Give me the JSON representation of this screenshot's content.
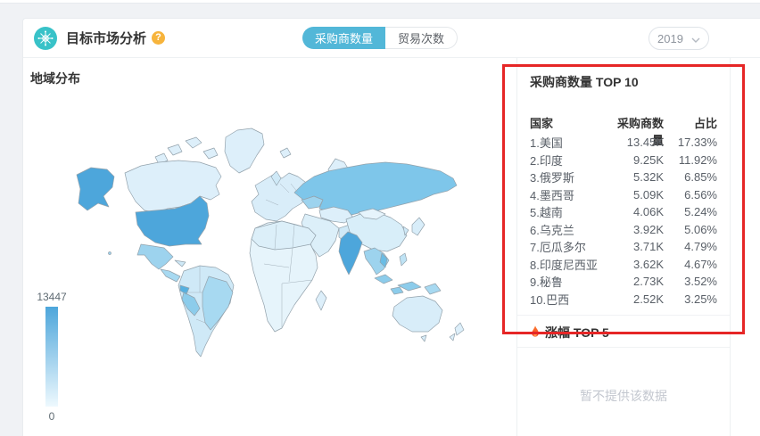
{
  "colors": {
    "icon_teal": "#38c2c8",
    "tab_active_bg": "#52b7d8",
    "annotation_red": "#e62626",
    "help_orange": "#f7b43c",
    "map_high": "#4da6db",
    "map_low": "#eef9fe",
    "flame_orange": "#ff8033",
    "flame_red": "#ef3c1f"
  },
  "header": {
    "title": "目标市场分析",
    "help_glyph": "?",
    "tabs": [
      {
        "label": "采购商数量",
        "active": true
      },
      {
        "label": "贸易次数",
        "active": false
      }
    ],
    "year": "2019"
  },
  "map_panel": {
    "title": "地域分布",
    "legend_max": "13447",
    "legend_min": "0"
  },
  "top10": {
    "title": "采购商数量 TOP 10",
    "columns": [
      "国家",
      "采购商数量",
      "占比"
    ],
    "rows": [
      {
        "country": "1.美国",
        "count": "13.45K",
        "pct": "17.33%"
      },
      {
        "country": "2.印度",
        "count": "9.25K",
        "pct": "11.92%"
      },
      {
        "country": "3.俄罗斯",
        "count": "5.32K",
        "pct": "6.85%"
      },
      {
        "country": "4.墨西哥",
        "count": "5.09K",
        "pct": "6.56%"
      },
      {
        "country": "5.越南",
        "count": "4.06K",
        "pct": "5.24%"
      },
      {
        "country": "6.乌克兰",
        "count": "3.92K",
        "pct": "5.06%"
      },
      {
        "country": "7.厄瓜多尔",
        "count": "3.71K",
        "pct": "4.79%"
      },
      {
        "country": "8.印度尼西亚",
        "count": "3.62K",
        "pct": "4.67%"
      },
      {
        "country": "9.秘鲁",
        "count": "2.73K",
        "pct": "3.52%"
      },
      {
        "country": "10.巴西",
        "count": "2.52K",
        "pct": "3.25%"
      }
    ]
  },
  "rise_panel": {
    "title": "涨幅 TOP 5",
    "empty_text": "暂不提供该数据"
  }
}
